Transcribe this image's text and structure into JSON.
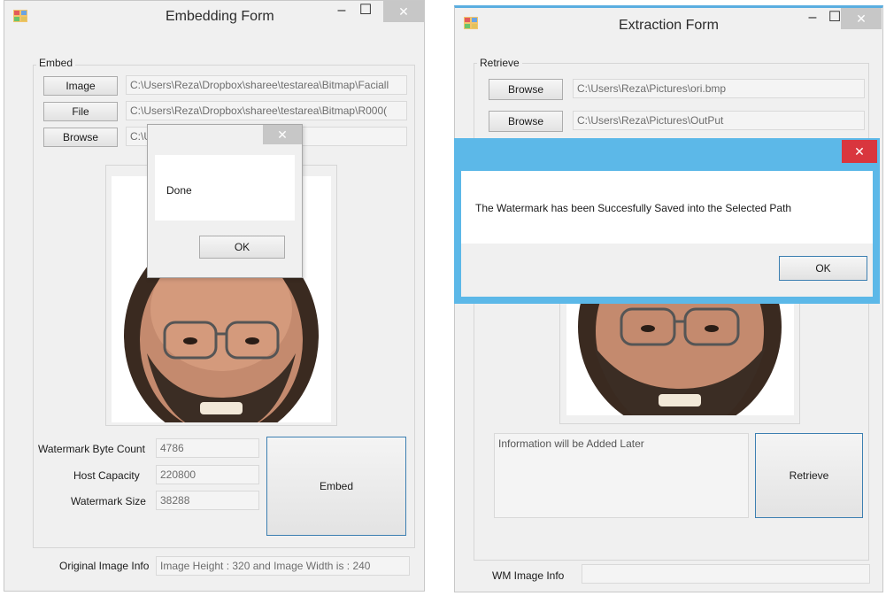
{
  "embedding_form": {
    "title": "Embedding Form",
    "minimize_glyph": "–",
    "maximize_glyph": "☐",
    "close_glyph": "✕",
    "group_label": "Embed",
    "image_button": "Image",
    "image_path": "C:\\Users\\Reza\\Dropbox\\sharee\\testarea\\Bitmap\\Faciall",
    "file_button": "File",
    "file_path": "C:\\Users\\Reza\\Dropbox\\sharee\\testarea\\Bitmap\\R000(",
    "browse_button": "Browse",
    "browse_path": "C:\\U",
    "watermark_byte_count_label": "Watermark Byte Count",
    "watermark_byte_count_value": "4786",
    "host_capacity_label": "Host Capacity",
    "host_capacity_value": "220800",
    "watermark_size_label": "Watermark Size",
    "watermark_size_value": "38288",
    "embed_button": "Embed",
    "original_image_info_label": "Original Image Info",
    "original_image_info_value": "Image Height : 320  and Image Width is : 240",
    "dialog": {
      "close_glyph": "✕",
      "message": "Done",
      "ok_button": "OK"
    }
  },
  "extraction_form": {
    "title": "Extraction Form",
    "minimize_glyph": "–",
    "maximize_glyph": "☐",
    "close_glyph": "✕",
    "group_label": "Retrieve",
    "browse_button_1": "Browse",
    "browse_path_1": "C:\\Users\\Reza\\Pictures\\ori.bmp",
    "browse_button_2": "Browse",
    "browse_path_2": "C:\\Users\\Reza\\Pictures\\OutPut",
    "info_text": "Information will be Added Later",
    "retrieve_button": "Retrieve",
    "wm_image_info_label": "WM Image Info",
    "wm_image_info_value": "",
    "dialog": {
      "close_glyph": "✕",
      "message": "The Watermark has been Succesfully Saved into the Selected Path",
      "ok_button": "OK"
    }
  },
  "colors": {
    "window_bg": "#f0f0f0",
    "dialog_border": "#5cb8e8",
    "close_red": "#d9363e",
    "primary_button_border": "#3c7fb1"
  }
}
